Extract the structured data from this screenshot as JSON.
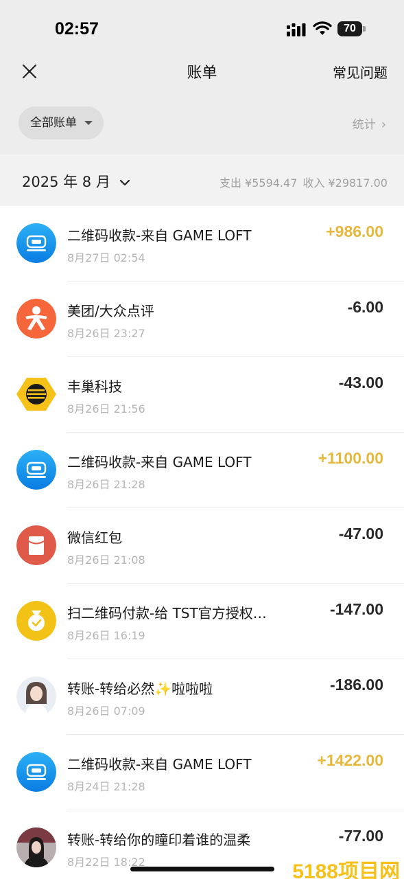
{
  "status_bar": {
    "time": "02:57",
    "battery": "70"
  },
  "nav": {
    "title": "账单",
    "faq": "常见问题",
    "close_icon": "close-icon"
  },
  "filter": {
    "all_bills": "全部账单",
    "stats": "统计"
  },
  "month": {
    "label": "2025 年 8 月",
    "expense": "支出 ¥5594.47",
    "income": "收入 ¥29817.00"
  },
  "transactions": [
    {
      "title": "二维码收款-来自 GAME LOFT",
      "time": "8月27日 02:54",
      "amount": "+986.00",
      "type": "income",
      "icon": "gameloft-icon"
    },
    {
      "title": "美团/大众点评",
      "time": "8月26日 23:27",
      "amount": "-6.00",
      "type": "expense",
      "icon": "dianping-icon"
    },
    {
      "title": "丰巢科技",
      "time": "8月26日 21:56",
      "amount": "-43.00",
      "type": "expense",
      "icon": "hive-box-icon"
    },
    {
      "title": "二维码收款-来自 GAME LOFT",
      "time": "8月26日 21:28",
      "amount": "+1100.00",
      "type": "income",
      "icon": "gameloft-icon"
    },
    {
      "title": "微信红包",
      "time": "8月26日 21:08",
      "amount": "-47.00",
      "type": "expense",
      "icon": "red-envelope-icon"
    },
    {
      "title": "扫二维码付款-给 TST官方授权…",
      "time": "8月26日 16:19",
      "amount": "-147.00",
      "type": "expense",
      "icon": "money-bag-icon"
    },
    {
      "title": "转账-转给必然✨啦啦啦",
      "time": "8月26日 07:09",
      "amount": "-186.00",
      "type": "expense",
      "icon": "user-avatar-1"
    },
    {
      "title": "二维码收款-来自 GAME LOFT",
      "time": "8月24日 21:28",
      "amount": "+1422.00",
      "type": "income",
      "icon": "gameloft-icon"
    },
    {
      "title": "转账-转给你的瞳印着谁的温柔",
      "time": "8月22日 18:22",
      "amount": "-77.00",
      "type": "expense",
      "icon": "user-avatar-2"
    }
  ],
  "watermark": "5188项目网",
  "colors": {
    "income": "#e6b83e",
    "expense": "#2a2a2a",
    "header_bg": "#ededed"
  }
}
